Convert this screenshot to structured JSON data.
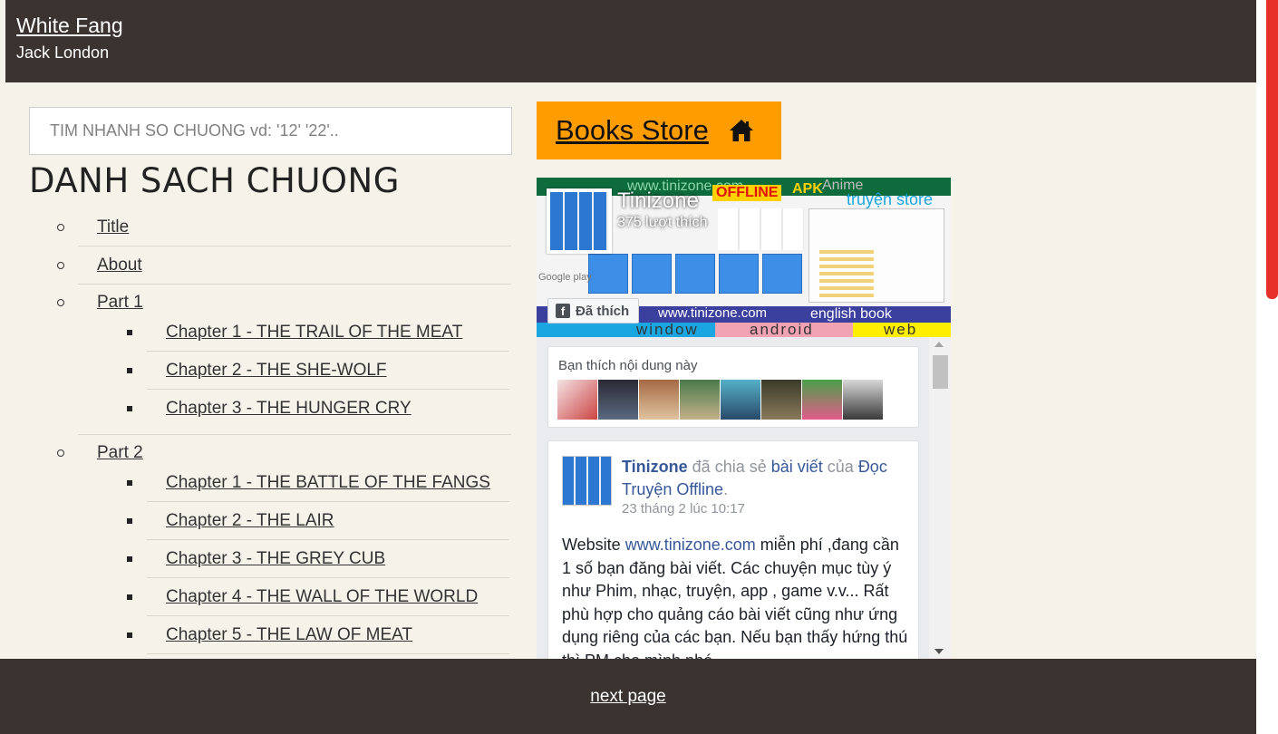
{
  "header": {
    "title": "White Fang",
    "author": "Jack London"
  },
  "search": {
    "placeholder": "TIM NHANH SO CHUONG vd: '12' '22'.."
  },
  "toc": {
    "heading": "DANH SACH CHUONG",
    "top_items": [
      "Title",
      "About"
    ],
    "parts": [
      {
        "label": "Part 1",
        "chapters": [
          "Chapter 1 - THE TRAIL OF THE MEAT",
          "Chapter 2 - THE SHE-WOLF",
          "Chapter 3 - THE HUNGER CRY"
        ]
      },
      {
        "label": "Part 2",
        "chapters": [
          "Chapter 1 - THE BATTLE OF THE FANGS",
          "Chapter 2 - THE LAIR",
          "Chapter 3 - THE GREY CUB",
          "Chapter 4 - THE WALL OF THE WORLD",
          "Chapter 5 - THE LAW OF MEAT"
        ]
      }
    ]
  },
  "store": {
    "label": "Books Store",
    "icon": "home-icon"
  },
  "fb": {
    "page_name": "Tinizone",
    "likes": "375 lượt thích",
    "like_button": "Đã thích",
    "cover": {
      "offline": "OFFLINE",
      "apk": "APK",
      "anime": "Anime",
      "store_text": "truyện store",
      "url": "www.tinizone.com",
      "english": "english book",
      "band": [
        "window",
        "android",
        "web"
      ],
      "google": "Google play"
    },
    "friends_label": "Bạn thích nội dung này",
    "post": {
      "author": "Tinizone",
      "shared": " đã chia sẻ ",
      "post_link": "bài viết",
      "of": " của ",
      "source": "Đọc Truyện Offline",
      "dot": ".",
      "time": "23 tháng 2 lúc 10:17",
      "body_1": "Website ",
      "body_link": "www.tinizone.com",
      "body_2": " miễn phí ,đang cần 1 số bạn đăng bài viết. Các chuyện mục tùy ý như Phim, nhạc, truyện, app , game v.v... Rất phù hợp cho quảng cáo bài viết cũng như ứng dụng riêng của các bạn. Nếu bạn thấy hứng thú thì PM cho mình nhé"
    }
  },
  "footer": {
    "next": "next page"
  },
  "colors": {
    "header_bg": "#3a3330",
    "page_bg": "#f5f2ea",
    "store_bg": "#ff9c00",
    "scroll_thumb": "#e8302a"
  }
}
